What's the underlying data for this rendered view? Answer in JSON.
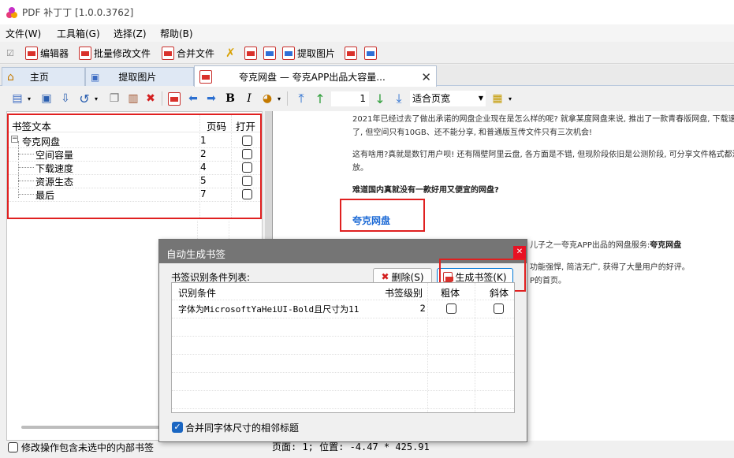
{
  "window": {
    "title": "PDF 补丁丁 [1.0.0.3762]"
  },
  "menu": [
    {
      "label": "文件(W)"
    },
    {
      "label": "工具箱(G)"
    },
    {
      "label": "选择(Z)"
    },
    {
      "label": "帮助(B)"
    }
  ],
  "toolbar1": {
    "editor": "编辑器",
    "batch_modify": "批量修改文件",
    "merge": "合并文件",
    "extract_images": "提取图片"
  },
  "tabs": [
    {
      "label": "主页",
      "icon": "home-icon"
    },
    {
      "label": "提取图片",
      "icon": "image-icon"
    },
    {
      "label": "夸克网盘 — 夸克APP出品大容量...",
      "icon": "pdf-icon"
    }
  ],
  "toolbar2": {
    "page_number": "1",
    "zoom": "适合页宽"
  },
  "bookmarks": {
    "headers": {
      "text": "书签文本",
      "page": "页码",
      "open": "打开"
    },
    "items": [
      {
        "text": "夸克网盘",
        "page": "1",
        "open": false,
        "level": 0
      },
      {
        "text": "空间容量",
        "page": "2",
        "open": false,
        "level": 1
      },
      {
        "text": "下载速度",
        "page": "4",
        "open": false,
        "level": 1
      },
      {
        "text": "资源生态",
        "page": "5",
        "open": false,
        "level": 1
      },
      {
        "text": "最后",
        "page": "7",
        "open": false,
        "level": 1
      }
    ]
  },
  "status_left": {
    "label": "修改操作包含未选中的内部书签",
    "checked": false
  },
  "status_right": "页面: 1; 位置: -4.47 * 425.91",
  "document": {
    "lines": [
      "2021年已经过去了做出承诺的网盘企业现在是怎么样的呢? 就拿某度网盘来说, 推出了一款青春版网盘, 下载速度是真",
      "了, 但空间只有10GB、还不能分享, 和普通版互传文件只有三次机会!",
      "这有啥用?真就是数钉用户呗! 还有隔壁阿里云盘, 各方面是不错, 但现阶段依旧是公测阶段, 可分享文件格式都没有",
      "放。"
    ],
    "bold_question": "难道国内真就没有一款好用又便宜的网盘?",
    "heading": "夸克网盘",
    "behind_dialog": [
      "儿子之一夸克APP出品的网盘服务:",
      "夸克网盘",
      "功能强悍, 简洁无广, 获得了大量用户的好评。",
      "P的首页。"
    ]
  },
  "dialog": {
    "title": "自动生成书签",
    "list_label": "书签识别条件列表:",
    "delete_button": "删除(S)",
    "generate_button": "生成书签(K)",
    "columns": {
      "condition": "识别条件",
      "level": "书签级别",
      "bold": "粗体",
      "italic": "斜体"
    },
    "rows": [
      {
        "condition": "字体为MicrosoftYaHeiUI-Bold且尺寸为11",
        "level": "2",
        "bold": false,
        "italic": false
      }
    ],
    "merge_label": "合并同字体尺寸的相邻标题",
    "merge_checked": true
  },
  "colors": {
    "highlight_red": "#e02020",
    "link_blue": "#1e6bd6",
    "dialog_title_bg": "#757575",
    "close_red": "#e81123"
  }
}
